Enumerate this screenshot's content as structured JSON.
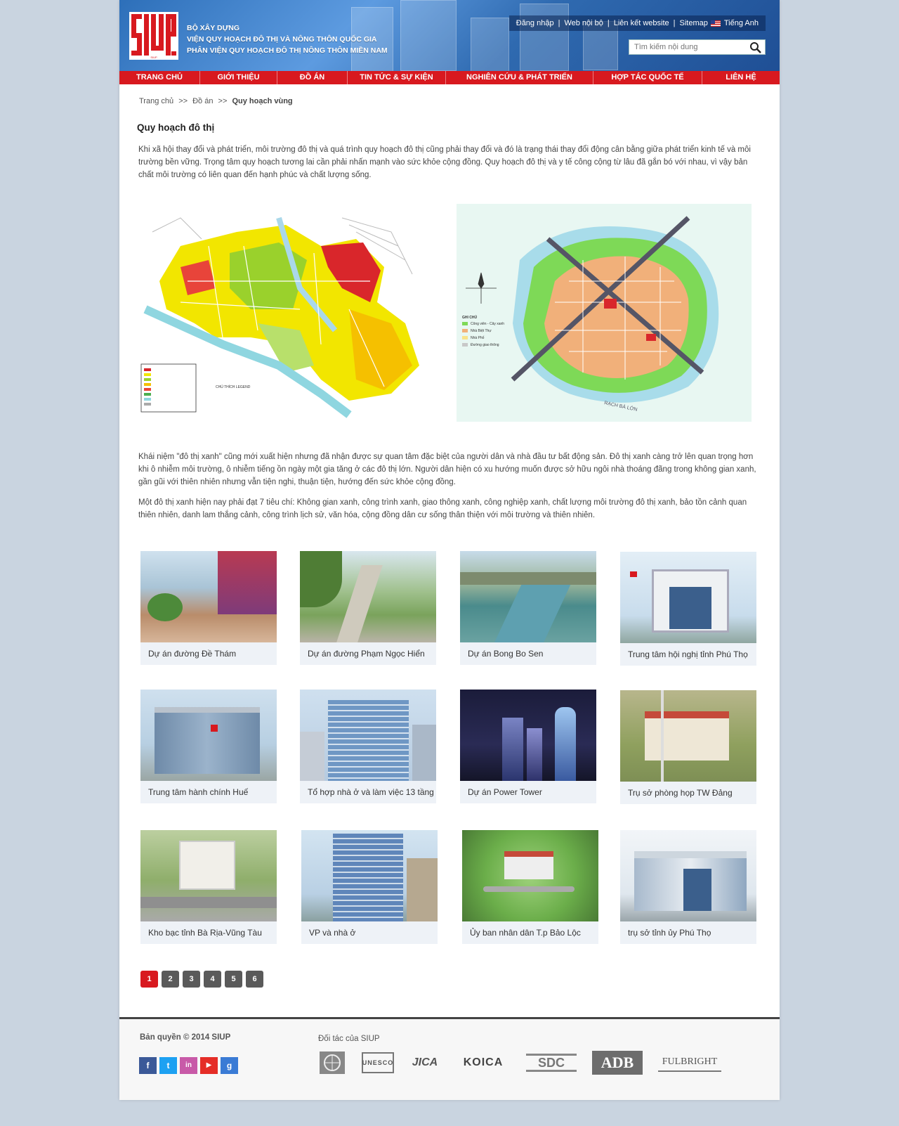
{
  "org": {
    "line1": "BỘ XÂY DỰNG",
    "line2": "VIỆN QUY HOẠCH ĐÔ THỊ VÀ NÔNG THÔN QUỐC GIA",
    "line3": "PHÂN VIỆN QUY HOẠCH ĐÔ THỊ NÔNG THÔN MIỀN NAM",
    "logo_text": "SIUP"
  },
  "toplinks": {
    "login": "Đăng nhập",
    "internal": "Web nội bộ",
    "links": "Liên kết website",
    "sitemap": "Sitemap",
    "language": "Tiếng Anh"
  },
  "search": {
    "placeholder": "Tìm kiếm nội dung"
  },
  "nav": [
    "TRANG CHỦ",
    "GIỚI THIỆU",
    "ĐỒ ÁN",
    "TIN TỨC & SỰ KIỆN",
    "NGHIÊN CỨU & PHÁT TRIỂN",
    "HỢP TÁC QUỐC TẾ",
    "LIÊN HỆ"
  ],
  "breadcrumb": {
    "home": "Trang chủ",
    "sep": ">>",
    "section": "Đồ án",
    "current": "Quy hoạch vùng"
  },
  "article": {
    "title": "Quy hoạch đô thị",
    "p1": "Khi xã hội thay đổi và phát triển, môi trường đô thị và quá trình quy hoạch đô thị cũng phải thay đổi và đó là trạng thái thay đổi động cân bằng giữa phát triển kinh tế và môi trường bền vững. Trọng tâm quy hoạch tương lai cần phải nhấn mạnh vào sức khỏe cộng đồng. Quy hoạch đô thị và y tế công cộng từ lâu đã gắn bó với nhau, vì vậy bản chất môi trường có liên quan đến hạnh phúc và chất lượng sống.",
    "p2": "Khái niệm \"đô thị xanh\" cũng mới xuất hiện nhưng đã nhận được sự quan tâm đặc biệt của người dân và nhà đầu tư bất động sản. Đô thị xanh càng trở lên quan trọng hơn khi ô nhiễm môi trường, ô nhiễm tiếng ồn ngày một gia tăng ở các đô thị lớn. Người dân hiện có xu hướng muốn được sở hữu ngôi nhà thoáng đãng trong không gian xanh, gần gũi với thiên nhiên nhưng vẫn tiện nghi, thuận tiện, hướng đến sức khỏe cộng đồng.",
    "p3": "Một đô thị xanh hiện nay phải đạt 7 tiêu chí: Không gian xanh, công trình xanh, giao thông xanh, công nghiệp xanh, chất lượng môi trường đô thị xanh, bảo tồn cảnh quan thiên nhiên, danh lam thắng cảnh, công trình lịch sử, văn hóa, cộng đồng dân cư sống thân thiện với môi trường và thiên nhiên."
  },
  "map_right": {
    "legend_title": "GHI CHÚ",
    "legend": [
      "Công viên - Cây xanh",
      "Nhà Biệt Thự",
      "Nhà Phố",
      "Đường giao thông"
    ],
    "river": "RẠCH BÀ LỚN"
  },
  "map_left": {
    "legend_title": "CHÚ THÍCH LEGEND"
  },
  "projects": [
    {
      "caption": "Dự án đường Đề Thám"
    },
    {
      "caption": "Dự án đường Phạm Ngọc Hiển"
    },
    {
      "caption": "Dự án Bong Bo Sen"
    },
    {
      "caption": "Trung tâm hội nghị tỉnh Phú Thọ"
    },
    {
      "caption": "Trung tâm hành chính Huế"
    },
    {
      "caption": "Tổ hợp nhà ở và làm việc 13 tầng"
    },
    {
      "caption": "Dự án Power Tower"
    },
    {
      "caption": "Trụ sở phòng họp TW Đảng"
    },
    {
      "caption": "Kho bạc tỉnh Bà Rịa-Vũng Tàu"
    },
    {
      "caption": "VP và nhà ở"
    },
    {
      "caption": "Ủy ban nhân dân T.p Bảo Lộc"
    },
    {
      "caption": "trụ sở tỉnh ủy Phú Thọ"
    }
  ],
  "pagination": [
    "1",
    "2",
    "3",
    "4",
    "5",
    "6"
  ],
  "footer": {
    "copyright": "Bản quyền © 2014 SIUP",
    "partners_label": "Đối tác của SIUP",
    "social": [
      "f",
      "t",
      "in",
      "▶",
      "g"
    ],
    "partners": [
      "UN",
      "UNESCO",
      "JICA",
      "KOICA",
      "SDC",
      "ADB",
      "FULBRIGHT"
    ]
  },
  "colors": {
    "brand_red": "#d8191f",
    "header_blue": "#3a7cc6"
  }
}
